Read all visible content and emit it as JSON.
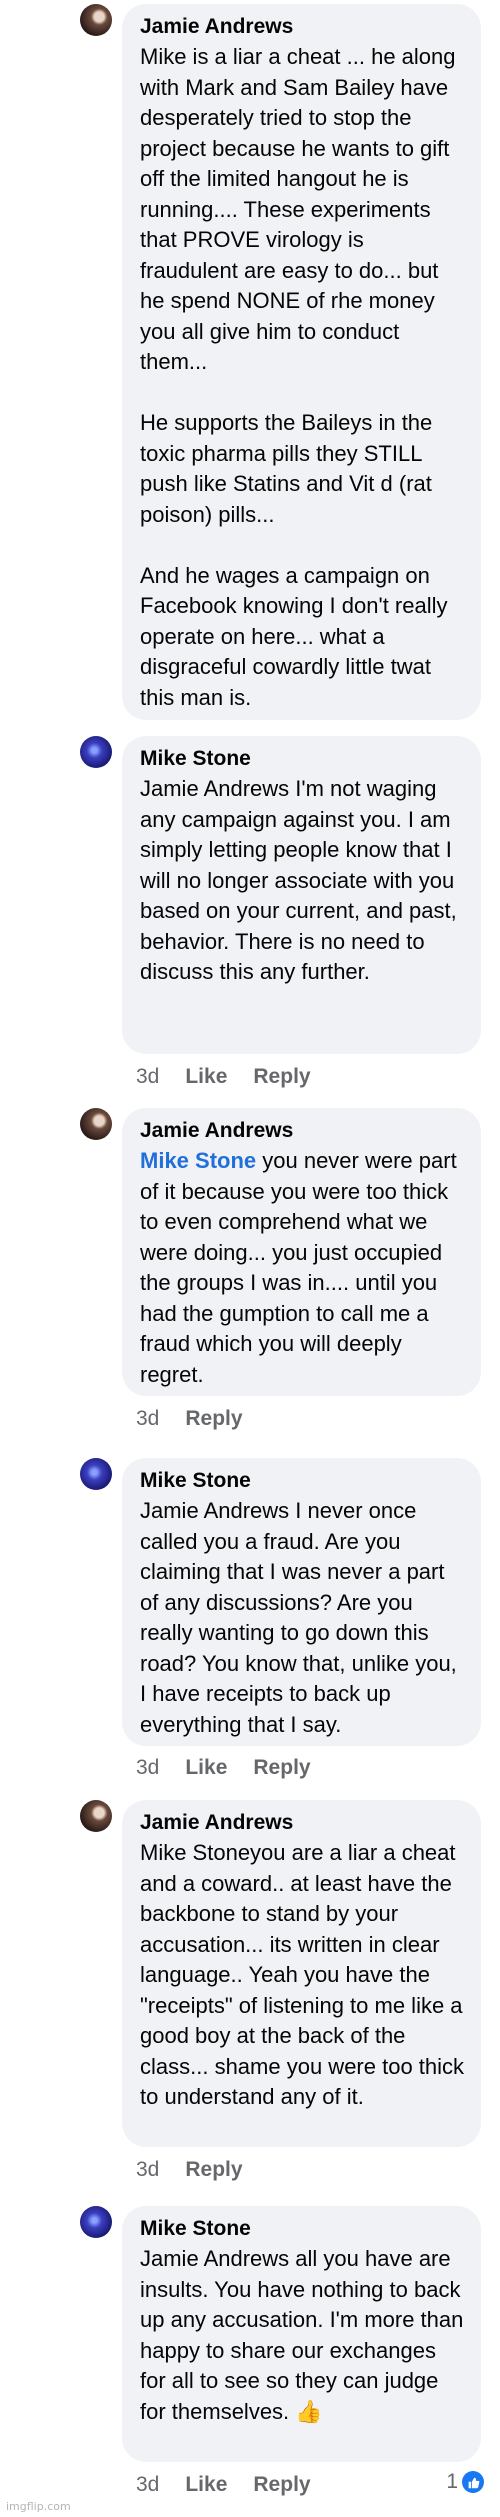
{
  "comments": [
    {
      "author": "Jamie Andrews",
      "text": "Mike is a liar a cheat ... he along with Mark and Sam Bailey have desperately tried to stop the project because he wants to gift off the limited hangout he is running.... These experiments that PROVE virology is fraudulent are easy to do... but he spend NONE of rhe money you all give him to conduct them...\n\nHe supports the Baileys in the toxic pharma pills they STILL push like Statins and Vit d (rat poison) pills...\n\nAnd he wages a campaign on Facebook knowing I don't really operate on here... what a disgraceful cowardly little twat this man is."
    },
    {
      "author": "Mike Stone",
      "text": "Jamie Andrews I'm not waging any campaign against you. I am simply letting people know that I will no longer associate with you based on your current, and past, behavior. There is no need to discuss this any further.",
      "time": "3d",
      "like": "Like",
      "reply": "Reply"
    },
    {
      "author": "Jamie Andrews",
      "mention": "Mike Stone",
      "text": " you never were part of it because you were too thick to even comprehend what we were doing... you just occupied the groups I was in.... until you had the gumption to call me a fraud which you will deeply regret.",
      "time": "3d",
      "reply": "Reply"
    },
    {
      "author": "Mike Stone",
      "text": "Jamie Andrews I never once called you a fraud. Are you claiming that I was never a part of any discussions? Are you really wanting to go down this road? You know that, unlike you, I have receipts to back up everything that I say.",
      "time": "3d",
      "like": "Like",
      "reply": "Reply"
    },
    {
      "author": "Jamie Andrews",
      "text": "Mike Stoneyou are a liar a cheat and a coward.. at least have the backbone to stand by your accusation... its written in clear language.. Yeah you have the \"receipts\" of listening to me like a good boy at the back of the class... shame you were too thick to understand any of it.",
      "time": "3d",
      "reply": "Reply"
    },
    {
      "author": "Mike Stone",
      "text": "Jamie Andrews all you have are insults. You have nothing to back up any accusation. I'm more than happy to share our exchanges for all to see so they can judge for themselves. 👍",
      "time": "3d",
      "like": "Like",
      "reply": "Reply",
      "reaction_count": "1"
    }
  ],
  "watermark": "imgflip.com",
  "colors": {
    "bubble": "#f0f2f5",
    "mention": "#216fdb",
    "meta": "#65676b",
    "like_badge": "#1877f2"
  }
}
